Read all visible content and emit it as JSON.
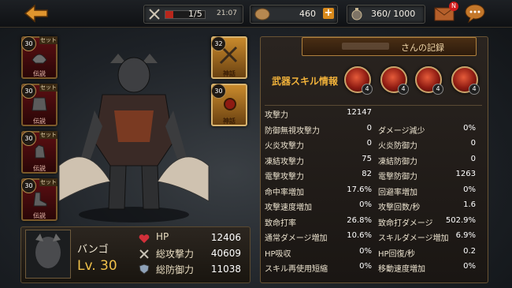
{
  "topbar": {
    "stamina_text": "1/5",
    "stamina_fill": 0.2,
    "timer": "21:07",
    "gold": "460",
    "stone": "360/ 1000",
    "mail_badge": "N"
  },
  "slots_left": [
    {
      "level": "30",
      "set": "セット",
      "tag": "伝説"
    },
    {
      "level": "30",
      "set": "セット",
      "tag": "伝説"
    },
    {
      "level": "30",
      "set": "セット",
      "tag": "伝説"
    },
    {
      "level": "30",
      "set": "セット",
      "tag": "伝説"
    }
  ],
  "slots_right": [
    {
      "level": "32",
      "tag": "神話"
    },
    {
      "level": "30",
      "tag": "神話"
    }
  ],
  "character": {
    "name": "バンゴ",
    "level": "Lv. 30",
    "hp_label": "HP",
    "hp": "12406",
    "atk_label": "総攻撃力",
    "atk": "40609",
    "def_label": "総防御力",
    "def": "11038"
  },
  "panel": {
    "name_suffix": "さんの記録",
    "skill_title": "武器スキル情報",
    "skills": [
      {
        "count": "4"
      },
      {
        "count": "4"
      },
      {
        "count": "4"
      },
      {
        "count": "4"
      }
    ],
    "stats": [
      {
        "l1": "攻撃力",
        "v1": "12147",
        "l2": "",
        "v2": ""
      },
      {
        "l1": "防御無視攻撃力",
        "v1": "0",
        "l2": "ダメージ減少",
        "v2": "0%"
      },
      {
        "l1": "火炎攻撃力",
        "v1": "0",
        "l2": "火炎防御力",
        "v2": "0"
      },
      {
        "l1": "凍結攻撃力",
        "v1": "75",
        "l2": "凍結防御力",
        "v2": "0"
      },
      {
        "l1": "電撃攻撃力",
        "v1": "82",
        "l2": "電撃防御力",
        "v2": "1263"
      },
      {
        "l1": "命中率増加",
        "v1": "17.6%",
        "l2": "回避率増加",
        "v2": "0%"
      },
      {
        "l1": "攻撃速度増加",
        "v1": "0%",
        "l2": "攻撃回数/秒",
        "v2": "1.6"
      },
      {
        "l1": "致命打率",
        "v1": "26.8%",
        "l2": "致命打ダメージ",
        "v2": "502.9%"
      },
      {
        "l1": "通常ダメージ増加",
        "v1": "10.6%",
        "l2": "スキルダメージ増加",
        "v2": "6.9%"
      },
      {
        "l1": "HP吸収",
        "v1": "0%",
        "l2": "HP回復/秒",
        "v2": "0.2"
      },
      {
        "l1": "スキル再使用短縮",
        "v1": "0%",
        "l2": "移動速度増加",
        "v2": "0%"
      }
    ]
  }
}
